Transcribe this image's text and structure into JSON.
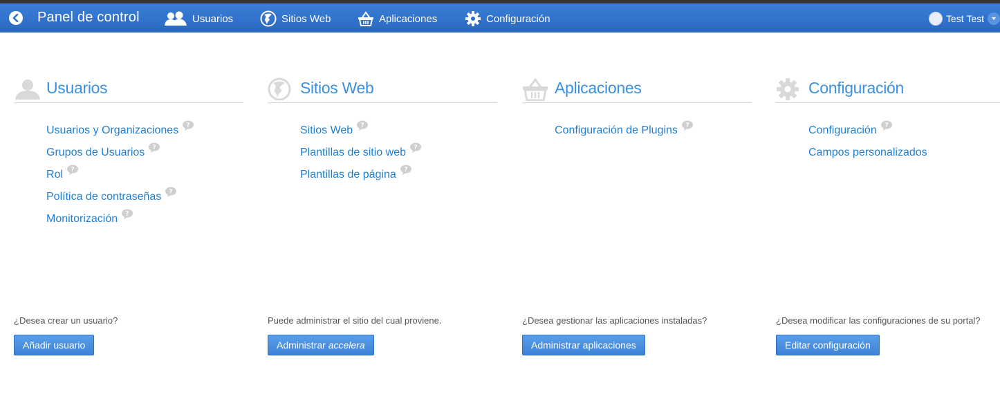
{
  "topbar": {
    "title": "Panel de control",
    "nav": [
      {
        "label": "Usuarios",
        "icon": "users-icon"
      },
      {
        "label": "Sitios Web",
        "icon": "globe-icon"
      },
      {
        "label": "Aplicaciones",
        "icon": "basket-icon"
      },
      {
        "label": "Configuración",
        "icon": "gear-icon"
      }
    ],
    "user": {
      "name": "Test Test"
    }
  },
  "columns": [
    {
      "title": "Usuarios",
      "icon": "users-icon",
      "links": [
        {
          "label": "Usuarios y Organizaciones",
          "help": true
        },
        {
          "label": "Grupos de Usuarios",
          "help": true
        },
        {
          "label": "Rol",
          "help": true
        },
        {
          "label": "Política de contraseñas",
          "help": true
        },
        {
          "label": "Monitorización",
          "help": true
        }
      ],
      "question": "¿Desea crear un usuario?",
      "button": "Añadir usuario"
    },
    {
      "title": "Sitios Web",
      "icon": "globe-icon",
      "links": [
        {
          "label": "Sitios Web",
          "help": true
        },
        {
          "label": "Plantillas de sitio web",
          "help": true
        },
        {
          "label": "Plantillas de página",
          "help": true
        }
      ],
      "question": "Puede administrar el sitio del cual proviene.",
      "button_prefix": "Administrar",
      "button_emphasis": "accelera"
    },
    {
      "title": "Aplicaciones",
      "icon": "basket-icon",
      "links": [
        {
          "label": "Configuración de Plugins",
          "help": true
        }
      ],
      "question": "¿Desea gestionar las aplicaciones instaladas?",
      "button": "Administrar aplicaciones"
    },
    {
      "title": "Configuración",
      "icon": "gear-icon",
      "links": [
        {
          "label": "Configuración",
          "help": true
        },
        {
          "label": "Campos personalizados",
          "help": false
        }
      ],
      "question": "¿Desea modificar las configuraciones de su portal?",
      "button": "Editar configuración"
    }
  ],
  "colors": {
    "topbar": "#2c6fcb",
    "accent": "#3d8fe0",
    "link": "#1f7ed2",
    "button": "#4a90e2"
  }
}
